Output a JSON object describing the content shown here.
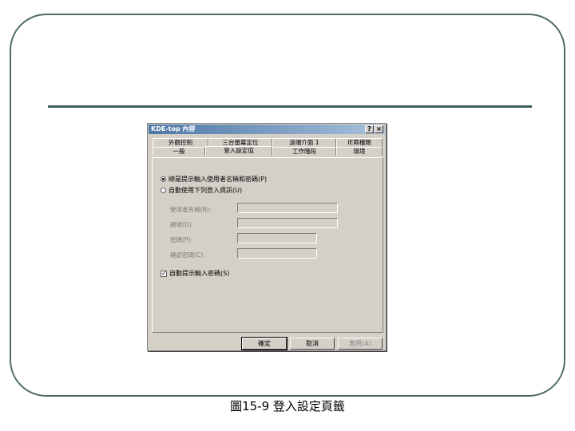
{
  "dialog": {
    "title": "KDE-top 內容",
    "help_label": "?",
    "close_label": "×",
    "tabs_row1": [
      "外觀控制",
      "三台螢幕定位",
      "遠端介面 1",
      "IE兩種類"
    ],
    "tabs_row2": [
      "一般",
      "登入設定值",
      "工作階段",
      "環境"
    ],
    "active_tab": "登入設定值"
  },
  "login": {
    "radio_prompt": "總是提示輸入使用者名稱和密碼(P)",
    "radio_auto": "自動使用下列登入資訊(U)",
    "username_label": "使用者名稱(N):",
    "domain_label": "網域(D):",
    "password_label": "密碼(P):",
    "confirm_label": "確認密碼(C):",
    "username_value": "",
    "domain_value": "",
    "password_value": "",
    "confirm_value": "",
    "checkbox_label": "自動提示輸入密碼(S)",
    "checkbox_mark": "✓"
  },
  "buttons": {
    "ok": "確定",
    "cancel": "取消",
    "apply": "套用(A)"
  },
  "caption": "圖15-9 登入設定頁籤"
}
